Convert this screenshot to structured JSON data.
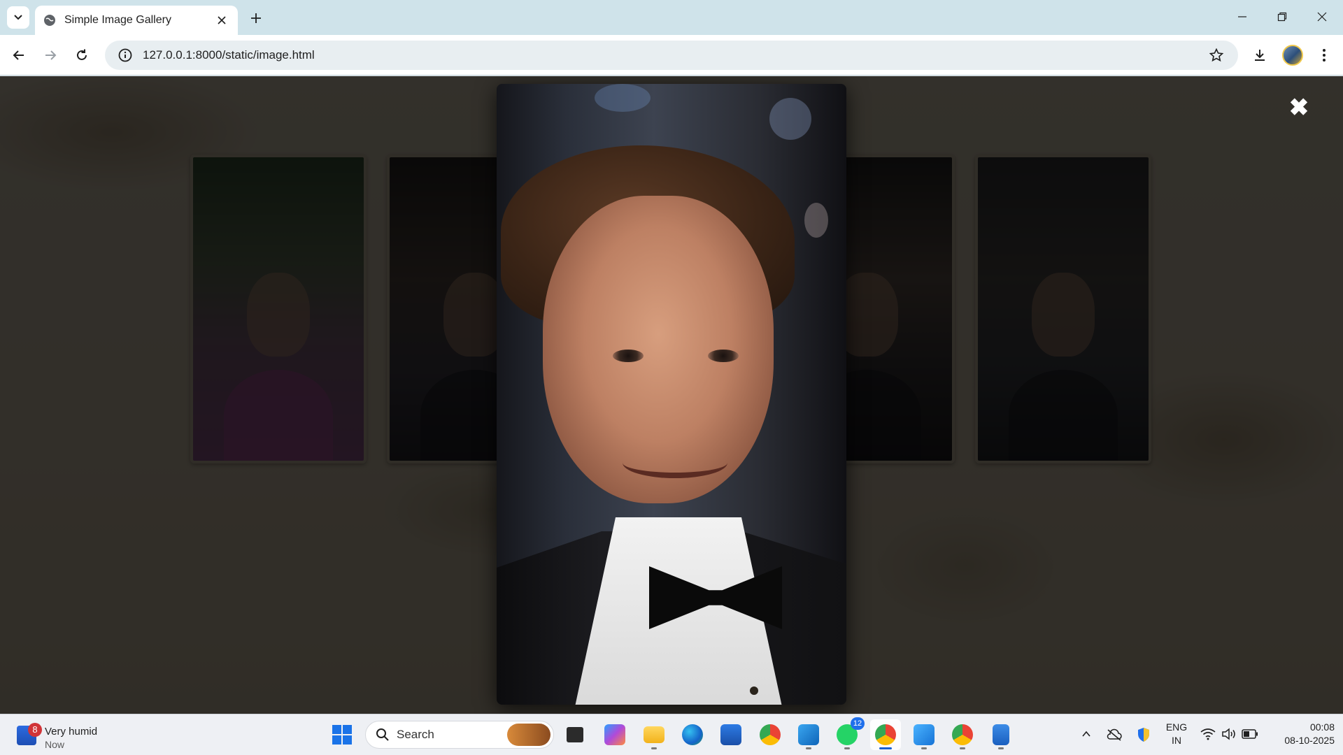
{
  "browser": {
    "tab_title": "Simple Image Gallery",
    "url": "127.0.0.1:8000/static/image.html"
  },
  "page": {
    "close_symbol": "✖",
    "thumbnails": [
      {
        "name": "thumbnail-1"
      },
      {
        "name": "thumbnail-2"
      },
      {
        "name": "thumbnail-3"
      },
      {
        "name": "thumbnail-4"
      }
    ]
  },
  "taskbar": {
    "weather_title": "Very humid",
    "weather_sub": "Now",
    "weather_badge": "8",
    "search_label": "Search",
    "whatsapp_badge": "12",
    "lang_line1": "ENG",
    "lang_line2": "IN",
    "time": "00:08",
    "date": "08-10-2025"
  },
  "colors": {
    "accent": "#1a5fd0",
    "tabstrip": "#cfe3ea",
    "overlay": "#000000"
  }
}
